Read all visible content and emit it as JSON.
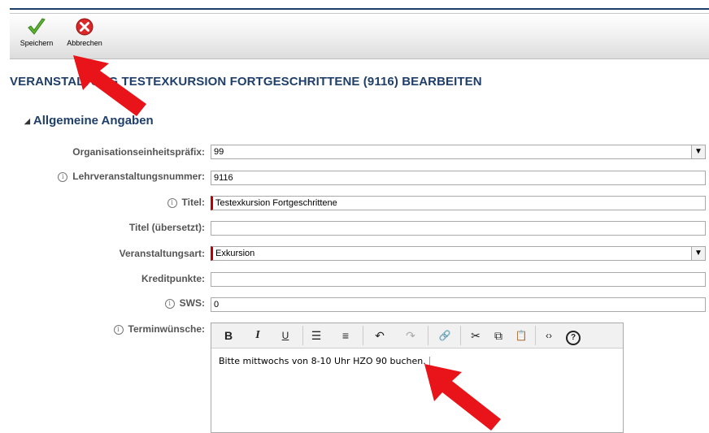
{
  "toolbar": {
    "save_label": "Speichern",
    "cancel_label": "Abbrechen"
  },
  "page": {
    "title": "VERANSTALTUNG  TESTEXKURSION FORTGESCHRITTENE (9116) BEARBEITEN"
  },
  "section": {
    "title": "Allgemeine Angaben",
    "collapse_glyph": "◢"
  },
  "form": {
    "org_prefix": {
      "label": "Organisationseinheitspräfix:",
      "value": "99"
    },
    "course_number": {
      "label": "Lehrveranstaltungsnummer:",
      "value": "9116"
    },
    "title": {
      "label": "Titel:",
      "value": "Testexkursion Fortgeschrittene"
    },
    "title_translated": {
      "label": "Titel (übersetzt):",
      "value": ""
    },
    "event_type": {
      "label": "Veranstaltungsart:",
      "value": "Exkursion"
    },
    "credits": {
      "label": "Kreditpunkte:",
      "value": ""
    },
    "sws": {
      "label": "SWS:",
      "value": "0"
    },
    "schedule": {
      "label": "Terminwünsche:",
      "value": "Bitte mittwochs von 8-10 Uhr HZO 90 buchen."
    }
  },
  "editor": {
    "buttons": {
      "bold": "B",
      "italic": "I",
      "underline": "U",
      "bullet_list": "☰",
      "numbered_list": "≡",
      "undo": "↶",
      "redo": "↷",
      "link": "🔗",
      "cut": "✂",
      "copy": "⧉",
      "paste": "📋",
      "source": "‹›",
      "help": "?"
    }
  },
  "icons": {
    "info": "i",
    "dropdown": "▼"
  },
  "colors": {
    "accent": "#1f3f6b",
    "required_marker": "#c00000",
    "annotation_arrow": "#e8141a"
  }
}
